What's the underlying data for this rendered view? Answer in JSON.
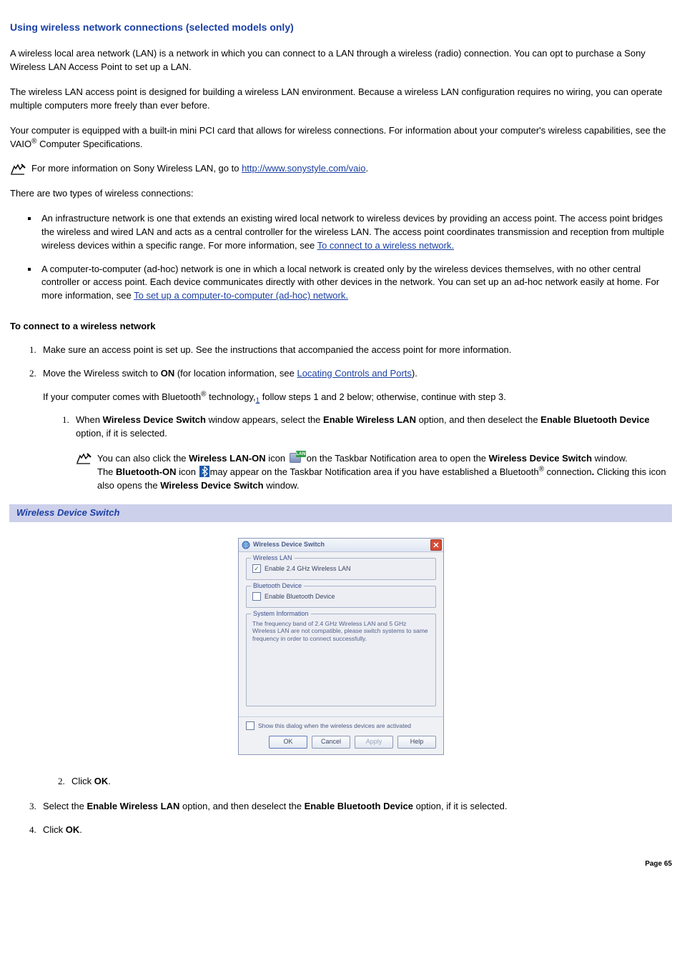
{
  "heading": "Using wireless network connections (selected models only)",
  "intro": {
    "p1": "A wireless local area network (LAN) is a network in which you can connect to a LAN through a wireless (radio) connection. You can opt to purchase a Sony Wireless LAN Access Point to set up a LAN.",
    "p2": "The wireless LAN access point is designed for building a wireless LAN environment. Because a wireless LAN configuration requires no wiring, you can operate multiple computers more freely than ever before.",
    "p3a": "Your computer is equipped with a built-in mini PCI card that allows for wireless connections. For information about your computer's wireless capabilities, see the VAIO",
    "p3b": " Computer Specifications."
  },
  "note1": {
    "before": "For more information on Sony Wireless LAN, go to ",
    "link": "http://www.sonystyle.com/vaio",
    "after": "."
  },
  "types_intro": "There are two types of wireless connections:",
  "types": {
    "item1_before": "An infrastructure network is one that extends an existing wired local network to wireless devices by providing an access point. The access point bridges the wireless and wired LAN and acts as a central controller for the wireless LAN. The access point coordinates transmission and reception from multiple wireless devices within a specific range. For more information, see ",
    "item1_link": "To connect to a wireless network.",
    "item2_before": "A computer-to-computer (ad-hoc) network is one in which a local network is created only by the wireless devices themselves, with no other central controller or access point. Each device communicates directly with other devices in the network. You can set up an ad-hoc network easily at home. For more information, see ",
    "item2_link": "To set up a computer-to-computer (ad-hoc) network."
  },
  "connect_heading": "To connect to a wireless network",
  "steps": {
    "s1": "Make sure an access point is set up. See the instructions that accompanied the access point for more information.",
    "s2_a": "Move the Wireless switch to ",
    "s2_on": "ON",
    "s2_b": " (for location information, see ",
    "s2_link": "Locating Controls and Ports",
    "s2_c": ").",
    "s2_p2a": "If your computer comes with Bluetooth",
    "s2_p2b": " technology,",
    "s2_fn": "1",
    "s2_p2c": " follow steps 1 and 2 below; otherwise, continue with step 3.",
    "sub1_a": "When ",
    "sub1_b": "Wireless Device Switch",
    "sub1_c": " window appears, select the ",
    "sub1_d": "Enable Wireless LAN",
    "sub1_e": " option, and then deselect the ",
    "sub1_f": "Enable Bluetooth Device",
    "sub1_g": " option, if it is selected.",
    "inline_note_a": "You can also click the ",
    "inline_note_b": "Wireless LAN-ON",
    "inline_note_c": " icon ",
    "inline_note_d": "on the Taskbar Notification area to open the ",
    "inline_note_e": "Wireless Device Switch",
    "inline_note_f": " window.",
    "bt_line_a": "The ",
    "bt_line_b": "Bluetooth-ON",
    "bt_line_c": " icon ",
    "bt_line_d": "may appear on the Taskbar Notification area if you have established a Bluetooth",
    "bt_line_e": " connection",
    "bt_line_f": " Clicking this icon also opens the ",
    "bt_line_g": "Wireless Device Switch",
    "bt_line_h": " window.",
    "sub2_a": "Click ",
    "sub2_b": "OK",
    "sub2_c": ".",
    "s3_a": "Select the ",
    "s3_b": "Enable Wireless LAN",
    "s3_c": " option, and then deselect the ",
    "s3_d": "Enable Bluetooth Device",
    "s3_e": " option, if it is selected.",
    "s4_a": "Click ",
    "s4_b": "OK",
    "s4_c": "."
  },
  "figure_caption": "Wireless Device Switch",
  "dialog": {
    "title": "Wireless Device Switch",
    "group1_legend": "Wireless LAN",
    "group1_cb_label": "Enable 2.4 GHz Wireless LAN",
    "group1_cb_checked": true,
    "group2_legend": "Bluetooth Device",
    "group2_cb_label": "Enable Bluetooth Device",
    "group2_cb_checked": false,
    "group3_legend": "System Information",
    "group3_text": "The frequency band of 2.4 GHz Wireless LAN and 5 GHz Wireless LAN are not compatible, please switch systems to same frequency in order to connect successfully.",
    "footer_cb_label": "Show this dialog when the wireless devices are activated",
    "footer_cb_checked": false,
    "btn_ok": "OK",
    "btn_cancel": "Cancel",
    "btn_apply": "Apply",
    "btn_help": "Help"
  },
  "lan_badge": "LAN",
  "page_number": "Page 65"
}
